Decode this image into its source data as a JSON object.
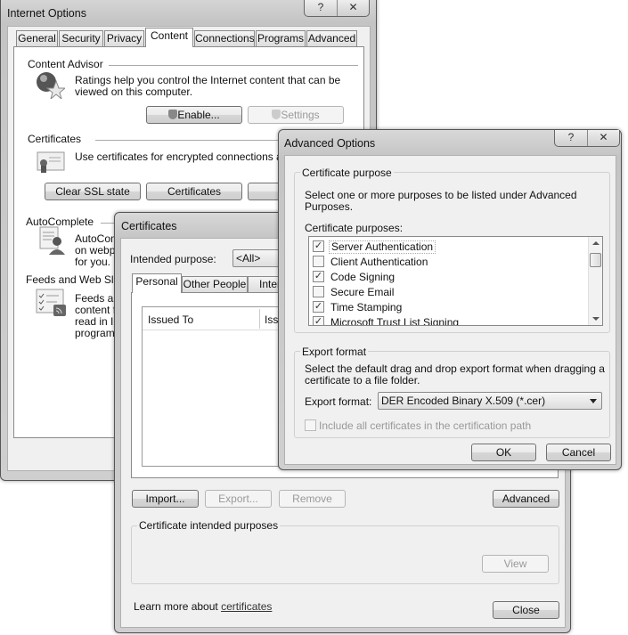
{
  "internet_options": {
    "title": "Internet Options",
    "help_icon": "?",
    "close_icon": "✕",
    "tabs": [
      {
        "label": "General",
        "selected": false
      },
      {
        "label": "Security",
        "selected": false
      },
      {
        "label": "Privacy",
        "selected": false
      },
      {
        "label": "Content",
        "selected": true
      },
      {
        "label": "Connections",
        "selected": false
      },
      {
        "label": "Programs",
        "selected": false
      },
      {
        "label": "Advanced",
        "selected": false
      }
    ],
    "content_advisor": {
      "heading": "Content Advisor",
      "line1": "Ratings help you control the Internet content that can be",
      "line2": "viewed on this computer.",
      "enable_label": "Enable...",
      "settings_label": "Settings"
    },
    "certificates": {
      "heading": "Certificates",
      "text": "Use certificates for encrypted connections and",
      "clear_ssl_label": "Clear SSL state",
      "certificates_label": "Certificates"
    },
    "autocomplete": {
      "heading": "AutoComplete",
      "line1": "AutoCom",
      "line2": "on webpa",
      "line3": "for you."
    },
    "feeds": {
      "heading": "Feeds and Web Slice",
      "line1": "Feeds an",
      "line2": "content f",
      "line3": "read in In",
      "line4": "programs"
    }
  },
  "certificates_dialog": {
    "title": "Certificates",
    "intended_purpose_label": "Intended purpose:",
    "intended_purpose_value": "<All>",
    "tabs": [
      {
        "label": "Personal",
        "selected": true
      },
      {
        "label": "Other People",
        "selected": false
      },
      {
        "label": "Interm",
        "selected": false
      }
    ],
    "columns": [
      "Issued To",
      "Iss"
    ],
    "import_label": "Import...",
    "export_label": "Export...",
    "remove_label": "Remove",
    "advanced_label": "Advanced",
    "intended_purposes_group": "Certificate intended purposes",
    "view_label": "View",
    "learn_more_prefix": "Learn more about ",
    "learn_more_link": "certificates",
    "close_label": "Close"
  },
  "advanced_options": {
    "title": "Advanced Options",
    "help_icon": "?",
    "close_icon": "✕",
    "purpose_group": "Certificate purpose",
    "purpose_desc_line1": "Select one or more purposes to be listed under Advanced",
    "purpose_desc_line2": "Purposes.",
    "purposes_label": "Certificate purposes:",
    "purposes": [
      {
        "label": "Server Authentication",
        "checked": true
      },
      {
        "label": "Client Authentication",
        "checked": false
      },
      {
        "label": "Code Signing",
        "checked": true
      },
      {
        "label": "Secure Email",
        "checked": false
      },
      {
        "label": "Time Stamping",
        "checked": true
      },
      {
        "label": "Microsoft Trust List Signing",
        "checked": true
      }
    ],
    "export_group": "Export format",
    "export_desc_line1": "Select the default drag and drop export format when dragging a",
    "export_desc_line2": "certificate to a file folder.",
    "export_format_label": "Export format:",
    "export_format_value": "DER Encoded Binary X.509 (*.cer)",
    "include_all_label": "Include all certificates in the certification path",
    "include_all_checked": false,
    "ok_label": "OK",
    "cancel_label": "Cancel"
  }
}
